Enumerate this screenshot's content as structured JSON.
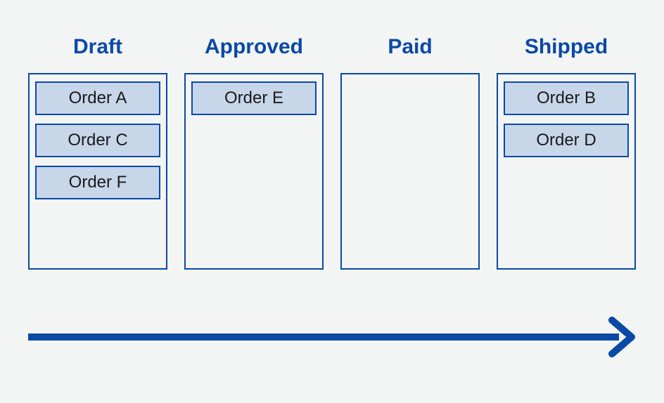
{
  "columns": [
    {
      "title": "Draft",
      "orders": [
        "Order A",
        "Order C",
        "Order F"
      ]
    },
    {
      "title": "Approved",
      "orders": [
        "Order E"
      ]
    },
    {
      "title": "Paid",
      "orders": []
    },
    {
      "title": "Shipped",
      "orders": [
        "Order B",
        "Order D"
      ]
    }
  ],
  "colors": {
    "accent": "#0a49a6",
    "card_bg": "#c8d6ea",
    "page_bg": "#f3f4f4"
  }
}
